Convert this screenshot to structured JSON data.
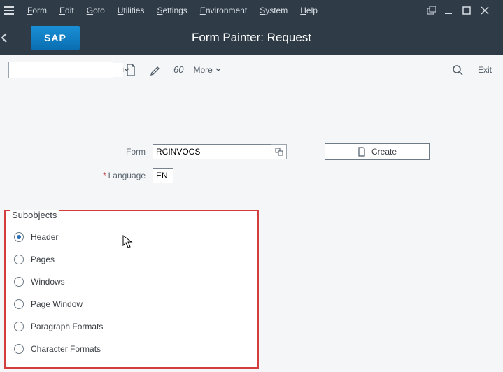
{
  "menubar": {
    "items": [
      {
        "pre": "F",
        "post": "orm"
      },
      {
        "pre": "E",
        "post": "dit"
      },
      {
        "pre": "G",
        "post": "oto"
      },
      {
        "pre": "U",
        "post": "tilities"
      },
      {
        "pre": "S",
        "post": "ettings"
      },
      {
        "pre": "E",
        "post": "nvironment"
      },
      {
        "pre": "S",
        "post": "ystem"
      },
      {
        "pre": "H",
        "post": "elp"
      }
    ]
  },
  "titlebar": {
    "logo": "SAP",
    "title": "Form Painter: Request"
  },
  "toolbar": {
    "combo_value": "",
    "display_tip": "Display",
    "glasses_label": "60",
    "more_label": "More",
    "exit_label": "Exit"
  },
  "form": {
    "form_label": "Form",
    "form_value": "RCINVOCS",
    "lang_label": "Language",
    "lang_value": "EN",
    "create_label": "Create"
  },
  "subobjects": {
    "group_label": "Subobjects",
    "options": [
      {
        "label": "Header",
        "selected": true
      },
      {
        "label": "Pages",
        "selected": false
      },
      {
        "label": "Windows",
        "selected": false
      },
      {
        "label": "Page Window",
        "selected": false
      },
      {
        "label": "Paragraph Formats",
        "selected": false
      },
      {
        "label": "Character Formats",
        "selected": false
      }
    ]
  }
}
